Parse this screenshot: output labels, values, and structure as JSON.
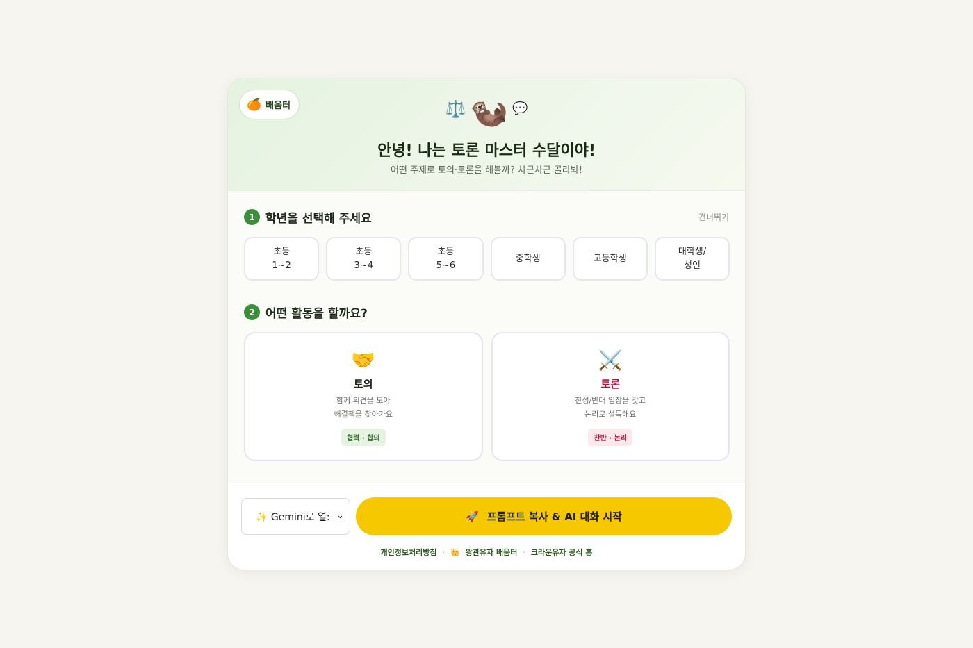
{
  "header": {
    "brand_label": "배움터",
    "brand_icon": "tangerine-icon",
    "emoji_left": "⚖️",
    "emoji_main": "🦦",
    "emoji_right": "💬",
    "title": "안녕! 나는 토론 마스터 수달이야!",
    "subtitle": "어떤 주제로 토의·토론을 해볼까? 차근차근 골라봐!"
  },
  "step1": {
    "number": "1",
    "title": "학년을 선택해 주세요",
    "skip_label": "건너뛰기",
    "grades": [
      {
        "label": "초등\n1~2"
      },
      {
        "label": "초등\n3~4"
      },
      {
        "label": "초등\n5~6"
      },
      {
        "label": "중학생"
      },
      {
        "label": "고등학생"
      },
      {
        "label": "대학생/\n성인"
      }
    ]
  },
  "step2": {
    "number": "2",
    "title": "어떤 활동을 할까요?",
    "activities": [
      {
        "icon": "🤝",
        "name": "토의",
        "desc": "함께 의견을 모아\n해결책을 찾아가요",
        "tag": "협력 · 합의"
      },
      {
        "icon": "⚔️",
        "name": "토론",
        "desc": "찬성/반대 입장을 갖고\n논리로 설득해요",
        "tag": "찬반 · 논리"
      }
    ]
  },
  "footer": {
    "select_value": "✨ Gemini로 열:",
    "cta_icon": "🚀",
    "cta_label": "프롬프트 복사 & AI 대화 시작",
    "link_privacy": "개인정보처리방침",
    "link_crown_icon": "👑",
    "link_royal": "왕관유자 배움터",
    "link_crown": "크라운유자 공식 홈",
    "separator": "·"
  },
  "colors": {
    "accent_green": "#3b8e3a",
    "cta_yellow": "#f5c800",
    "debate_red": "#b1153b"
  }
}
